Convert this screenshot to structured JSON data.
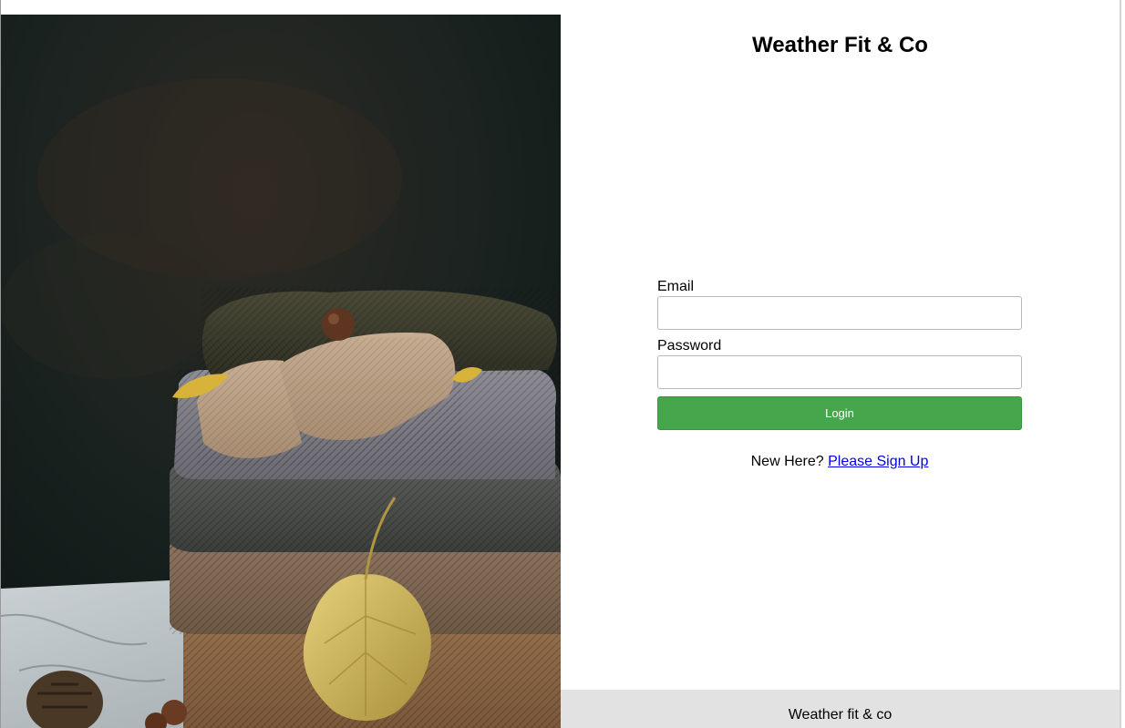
{
  "app": {
    "title": "Weather Fit & Co"
  },
  "hero_image": {
    "description_icon": "folded-sweaters-image"
  },
  "login_form": {
    "email_label": "Email",
    "email_value": "",
    "password_label": "Password",
    "password_value": "",
    "login_label": "Login",
    "signup_prompt": "New Here?",
    "signup_link": "Please Sign Up"
  },
  "footer": {
    "text": "Weather fit & co"
  },
  "colors": {
    "login_button": "#46a64b",
    "footer_bg": "#e2e2e2",
    "link": "#0000ee"
  }
}
